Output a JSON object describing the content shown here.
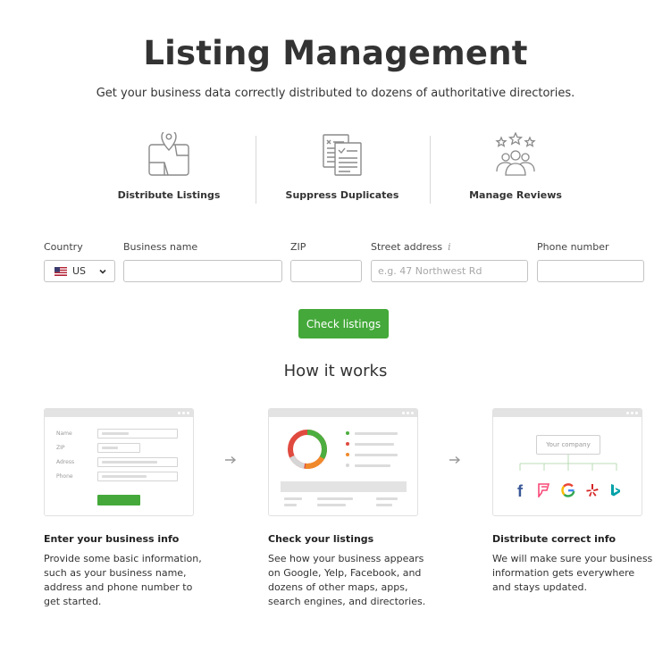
{
  "header": {
    "title": "Listing Management",
    "subtitle": "Get your business data correctly distributed to dozens of authoritative directories."
  },
  "features": [
    {
      "label": "Distribute Listings",
      "icon": "map-pin-icon"
    },
    {
      "label": "Suppress Duplicates",
      "icon": "documents-check-icon"
    },
    {
      "label": "Manage Reviews",
      "icon": "stars-people-icon"
    }
  ],
  "form": {
    "country_label": "Country",
    "country_value": "US",
    "business_label": "Business name",
    "zip_label": "ZIP",
    "street_label": "Street address",
    "street_info": "i",
    "street_placeholder": "e.g. 47 Northwest Rd",
    "phone_label": "Phone number",
    "button": "Check listings"
  },
  "how": {
    "title": "How it works",
    "steps": [
      {
        "title": "Enter your business info",
        "desc": [
          "Provide some basic information,",
          "such as your business name,",
          "address and phone number to",
          "get started."
        ],
        "mock": {
          "labels": [
            "Name",
            "ZIP",
            "Adress",
            "Phone"
          ]
        }
      },
      {
        "title": "Check your listings",
        "desc": [
          "See how your business appears",
          "on Google, Yelp, Facebook, and",
          "dozens of other maps, apps,",
          "search engines, and directories."
        ]
      },
      {
        "title": "Distribute correct info",
        "desc": [
          "We will make sure your business",
          "information gets everywhere",
          "and stays updated."
        ],
        "mock": {
          "company": "Your company"
        }
      }
    ]
  },
  "colors": {
    "accent": "#44a93a",
    "text": "#333333",
    "border": "#c4c4c4"
  }
}
